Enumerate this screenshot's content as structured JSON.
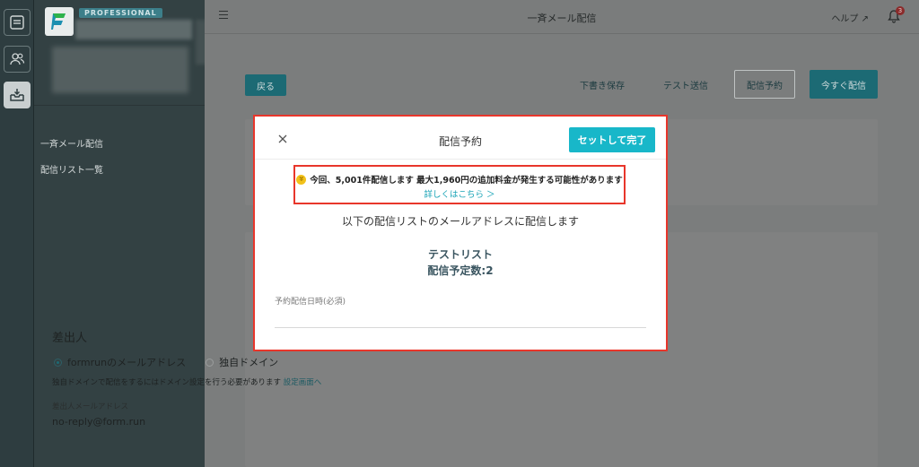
{
  "rail": {
    "items": [
      {
        "icon": "document-list-icon"
      },
      {
        "icon": "users-icon"
      },
      {
        "icon": "inbox-send-icon"
      }
    ]
  },
  "sidebar": {
    "plan": "PROFESSIONAL",
    "links": [
      "一斉メール配信",
      "配信リスト一覧"
    ]
  },
  "header": {
    "title": "一斉メール配信",
    "help": "ヘルプ",
    "notifications": "3"
  },
  "toolbar": {
    "back": "戻る",
    "save_draft": "下書き保存",
    "test_send": "テスト送信",
    "schedule": "配信予約",
    "send_now": "今すぐ配信"
  },
  "sender": {
    "label": "差出人",
    "option_formrun": "formrunのメールアドレス",
    "option_domain": "独自ドメイン",
    "note": "独自ドメインで配信をするにはドメイン設定を行う必要があります",
    "note_link": "設定画面へ",
    "email_label": "差出人メールアドレス",
    "email": "no-reply@form.run"
  },
  "modal": {
    "title": "配信予約",
    "confirm": "セットして完了",
    "warning": "今回、5,001件配信します 最大1,960円の追加料金が発生する可能性があります",
    "warning_link": "詳しくはこちら ＞",
    "lead": "以下の配信リストのメールアドレスに配信します",
    "list_name": "テストリスト",
    "list_count": "配信予定数:2",
    "schedule_label": "予約配信日時(必須)",
    "schedule_value": ""
  },
  "colors": {
    "accent": "#18b7c9",
    "highlight": "#e8362b",
    "sidebar": "#334143"
  }
}
